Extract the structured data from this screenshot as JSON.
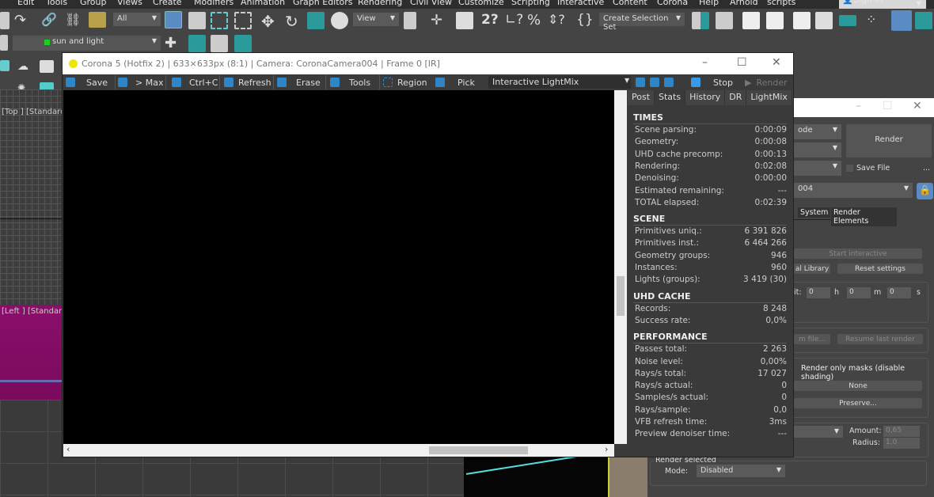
{
  "menu": [
    "Edit",
    "Tools",
    "Group",
    "Views",
    "Create",
    "Modifiers",
    "Animation",
    "Graph Editors",
    "Rendering",
    "Civil View",
    "Customize",
    "Scripting",
    "Interactive",
    "Content",
    "Corona",
    "Help",
    "Arnold",
    "scripts"
  ],
  "sign_in": "Sign In",
  "toolbar": {
    "filter": "All",
    "ref_coord": "View",
    "selection_set": "Create Selection Set",
    "layer": "sun and light"
  },
  "viewports": {
    "top_label": "[Top ] [Standard",
    "left_label": "[Left ] [Standard"
  },
  "vfb": {
    "title": "Corona 5 (Hotfix 2) | 633×633px (8:1) | Camera: CoronaCamera004 | Frame 0 [IR]",
    "buttons": {
      "save": "Save",
      "max": "> Max",
      "copy": "Ctrl+C",
      "refresh": "Refresh",
      "erase": "Erase",
      "tools": "Tools",
      "region": "Region",
      "pick": "Pick",
      "stop": "Stop",
      "render": "Render"
    },
    "channel": "Interactive LightMix",
    "tabs": [
      "Post",
      "Stats",
      "History",
      "DR",
      "LightMix"
    ],
    "active_tab": "Stats",
    "sections": [
      {
        "title": "TIMES",
        "rows": [
          [
            "Scene parsing:",
            "0:00:09"
          ],
          [
            "Geometry:",
            "0:00:08"
          ],
          [
            "UHD cache precomp:",
            "0:00:13"
          ],
          [
            "Rendering:",
            "0:02:08"
          ],
          [
            "Denoising:",
            "0:00:00"
          ],
          [
            "Estimated remaining:",
            "---"
          ],
          [
            "TOTAL elapsed:",
            "0:02:39"
          ]
        ]
      },
      {
        "title": "SCENE",
        "rows": [
          [
            "Primitives uniq.:",
            "6 391 826"
          ],
          [
            "Primitives inst.:",
            "6 464 266"
          ],
          [
            "Geometry groups:",
            "946"
          ],
          [
            "Instances:",
            "960"
          ],
          [
            "Lights (groups):",
            "3 419 (30)"
          ]
        ]
      },
      {
        "title": "UHD CACHE",
        "rows": [
          [
            "Records:",
            "8 248"
          ],
          [
            "Success rate:",
            "0,0%"
          ]
        ]
      },
      {
        "title": "PERFORMANCE",
        "rows": [
          [
            "Passes total:",
            "2 263"
          ],
          [
            "Noise level:",
            "0,00%"
          ],
          [
            "Rays/s total:",
            "17 027"
          ],
          [
            "Rays/s actual:",
            "0"
          ],
          [
            "Samples/s actual:",
            "0"
          ],
          [
            "Rays/sample:",
            "0,0"
          ],
          [
            "VFB refresh time:",
            "3ms"
          ],
          [
            "Preview denoiser time:",
            "---"
          ]
        ]
      }
    ]
  },
  "render_setup": {
    "mode_dd": "ode",
    "render": "Render",
    "save_file": "Save File",
    "more": "...",
    "camera": "004",
    "tabs": [
      "System",
      "Render Elements"
    ],
    "start_interactive": "Start interactive",
    "library": "al Library",
    "reset": "Reset settings",
    "limit_label": "it:",
    "h": "0",
    "m": "0",
    "s": "0",
    "h_unit": "h",
    "m_unit": "m",
    "s_unit": "s",
    "from_file": "m file...",
    "resume": "Resume last render",
    "masks": "Render only masks (disable shading)",
    "none": "None",
    "preserve": "Preserve...",
    "amount_label": "Amount:",
    "amount": "0,65",
    "radius_label": "Radius:",
    "radius": "1,0",
    "render_selected": "Render selected",
    "mode_label": "Mode:",
    "mode": "Disabled"
  }
}
